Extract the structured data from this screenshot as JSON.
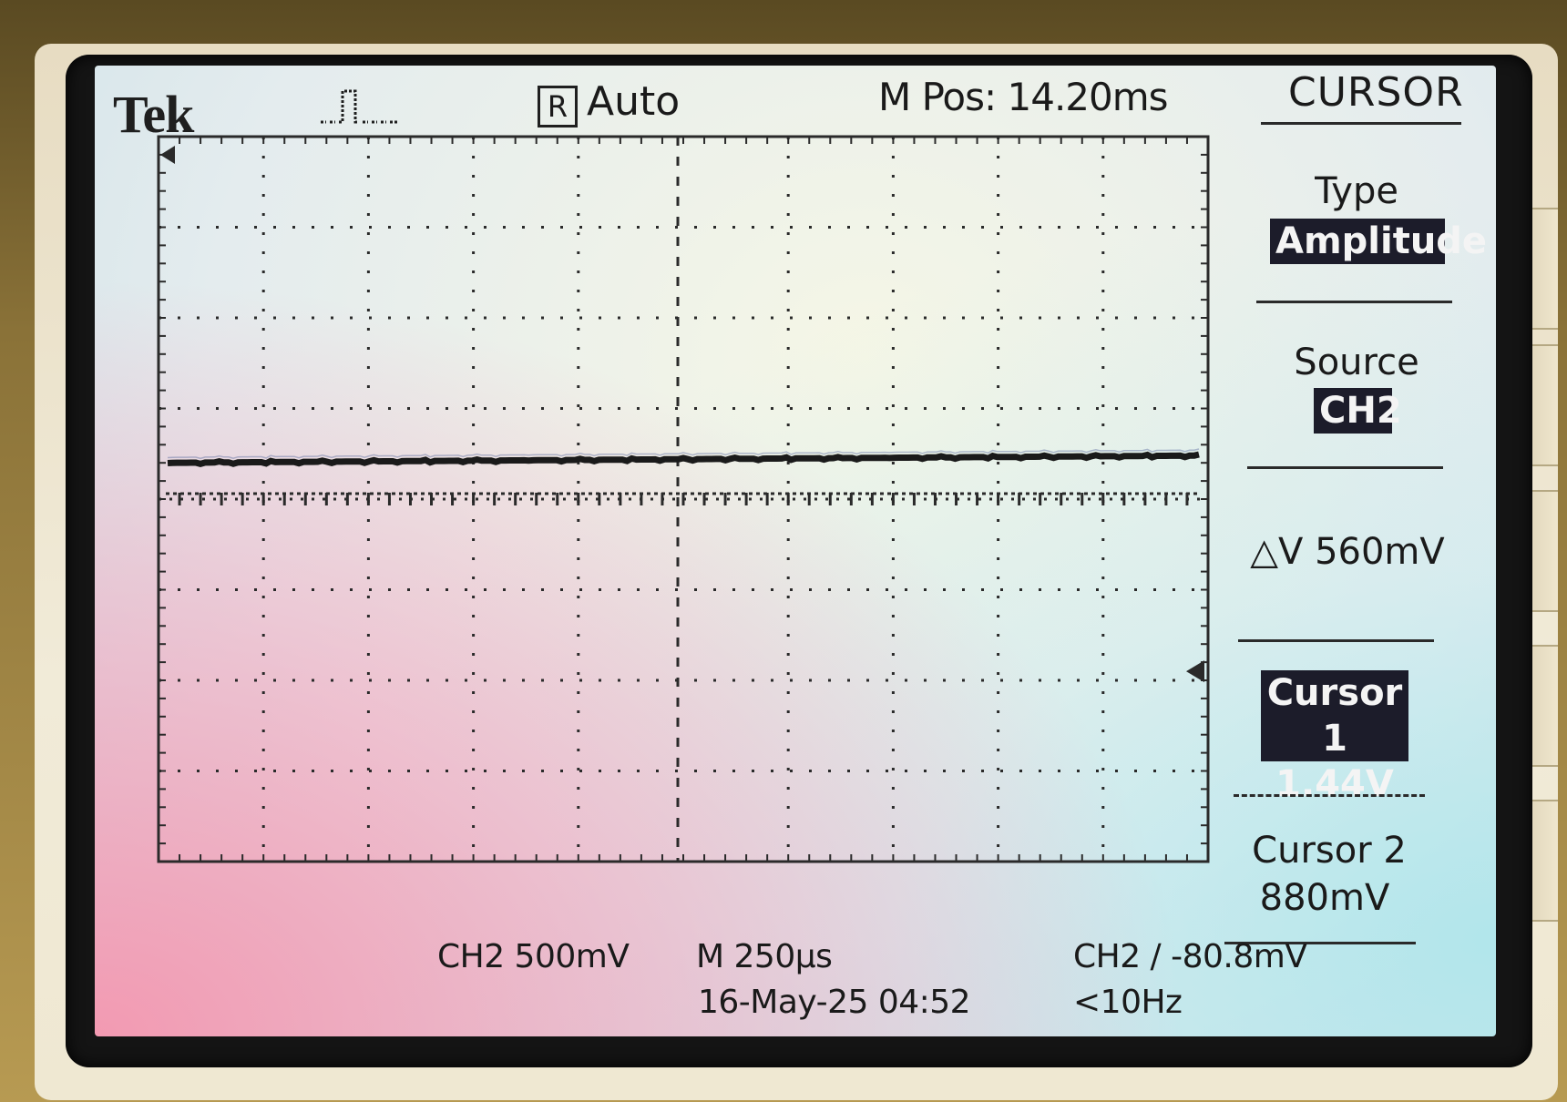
{
  "header": {
    "brand": "Tek",
    "acq_state_marker": "R",
    "trigger_mode": "Auto",
    "main_position": "M Pos: 14.20ms"
  },
  "menu": {
    "title": "CURSOR",
    "type_label": "Type",
    "type_value": "Amplitude",
    "source_label": "Source",
    "source_value": "CH2",
    "delta_v": "△V 560mV",
    "cursor1_label": "Cursor 1",
    "cursor1_value": "1.44V",
    "cursor2_label": "Cursor 2",
    "cursor2_value": "880mV"
  },
  "status_bar": {
    "ch_scale": "CH2  500mV",
    "time_scale": "M 250µs",
    "trigger_info": "CH2 ∕ -80.8mV",
    "datetime": "16-May-25 04:52",
    "frequency": "<10Hz"
  },
  "graticule": {
    "channel_marker": "2",
    "cols": 10,
    "rows": 8
  },
  "waveform": {
    "channel": "CH2",
    "level_divisions": 2.1
  },
  "cursors": {
    "cursor1_divisions": 2.88,
    "cursor2_divisions": 1.76
  },
  "colors": {
    "trace": "#1a1a1a",
    "highlight_bg": "#1c1c2a",
    "highlight_text": "#f4f4f4"
  }
}
